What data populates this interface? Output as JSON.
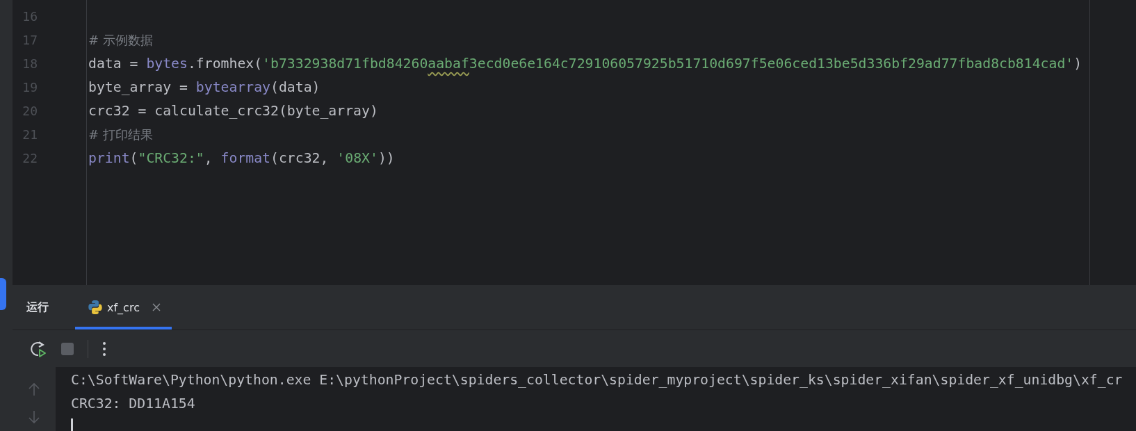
{
  "editor": {
    "lines": [
      {
        "number": "16"
      },
      {
        "number": "17",
        "tokens": [
          {
            "kind": "comment",
            "text": "# 示例数据"
          }
        ]
      },
      {
        "number": "18",
        "tokens": [
          {
            "kind": "plain",
            "text": "data = "
          },
          {
            "kind": "builtin",
            "text": "bytes"
          },
          {
            "kind": "plain",
            "text": ".fromhex("
          },
          {
            "kind": "string",
            "text": "'b7332938d71fbd84260"
          },
          {
            "kind": "string",
            "text": "aabaf",
            "squiggle": true
          },
          {
            "kind": "string",
            "text": "3ecd0e6e164c729106057925b51710d697f5e06ced13be5d336bf29ad77fbad8cb814cad'"
          },
          {
            "kind": "plain",
            "text": ")"
          }
        ]
      },
      {
        "number": "19",
        "tokens": [
          {
            "kind": "plain",
            "text": "byte_array = "
          },
          {
            "kind": "builtin",
            "text": "bytearray"
          },
          {
            "kind": "plain",
            "text": "(data)"
          }
        ]
      },
      {
        "number": "20",
        "tokens": [
          {
            "kind": "plain",
            "text": "crc32 = calculate_crc32(byte_array)"
          }
        ]
      },
      {
        "number": "21",
        "tokens": [
          {
            "kind": "comment",
            "text": "# 打印结果"
          }
        ]
      },
      {
        "number": "22",
        "tokens": [
          {
            "kind": "builtin",
            "text": "print"
          },
          {
            "kind": "plain",
            "text": "("
          },
          {
            "kind": "string",
            "text": "\"CRC32:\""
          },
          {
            "kind": "plain",
            "text": ", "
          },
          {
            "kind": "builtin",
            "text": "format"
          },
          {
            "kind": "plain",
            "text": "(crc32, "
          },
          {
            "kind": "string",
            "text": "'08X'"
          },
          {
            "kind": "plain",
            "text": "))"
          }
        ]
      }
    ]
  },
  "run_panel": {
    "title": "运行",
    "tabs": [
      {
        "label": "xf_crc",
        "selected": true
      }
    ],
    "console": {
      "lines": [
        "C:\\SoftWare\\Python\\python.exe E:\\pythonProject\\spiders_collector\\spider_myproject\\spider_ks\\spider_xifan\\spider_xf_unidbg\\xf_cr",
        "CRC32: DD11A154"
      ]
    }
  }
}
